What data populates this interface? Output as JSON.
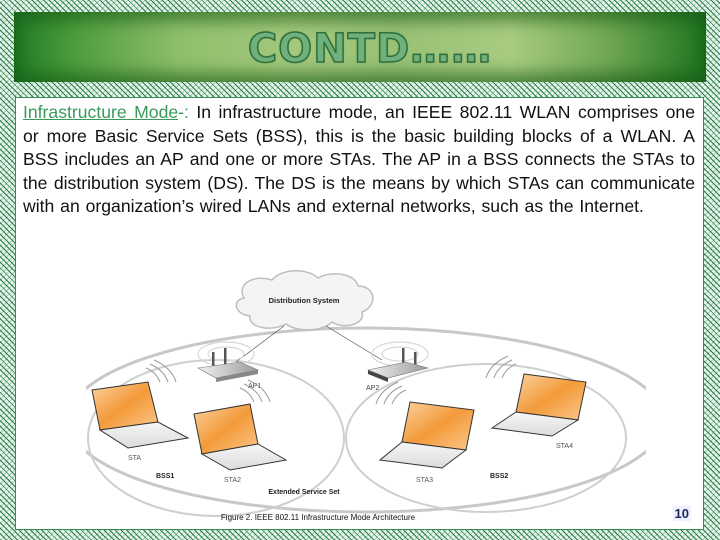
{
  "slide": {
    "title": "CONTD……",
    "page_number": "10"
  },
  "paragraph": {
    "term": "Infrastructure Mode",
    "separator": "-:",
    "body": " In infrastructure mode, an IEEE 802.11 WLAN comprises one or more Basic Service Sets (BSS), this is the basic building blocks of a WLAN. A BSS includes an AP and one or more STAs. The AP in a BSS connects the STAs to the distribution system (DS). The DS is the means by which STAs can communicate with an organization’s wired LANs and external networks, such as the Internet."
  },
  "figure": {
    "cloud_label": "Distribution System",
    "ap1_label": "AP1",
    "ap2_label": "AP2",
    "sta1_label": "STA",
    "sta2_label": "STA2",
    "sta3_label": "STA3",
    "sta4_label": "STA4",
    "bss1_label": "BSS1",
    "bss2_label": "BSS2",
    "ess_label": "Extended Service Set",
    "caption": "Figure 2. IEEE 802.11 Infrastructure Mode Architecture",
    "colors": {
      "screen": "#f39a3a",
      "screen_light": "#fbd3a0",
      "ellipse": "#cfcfcf"
    }
  }
}
